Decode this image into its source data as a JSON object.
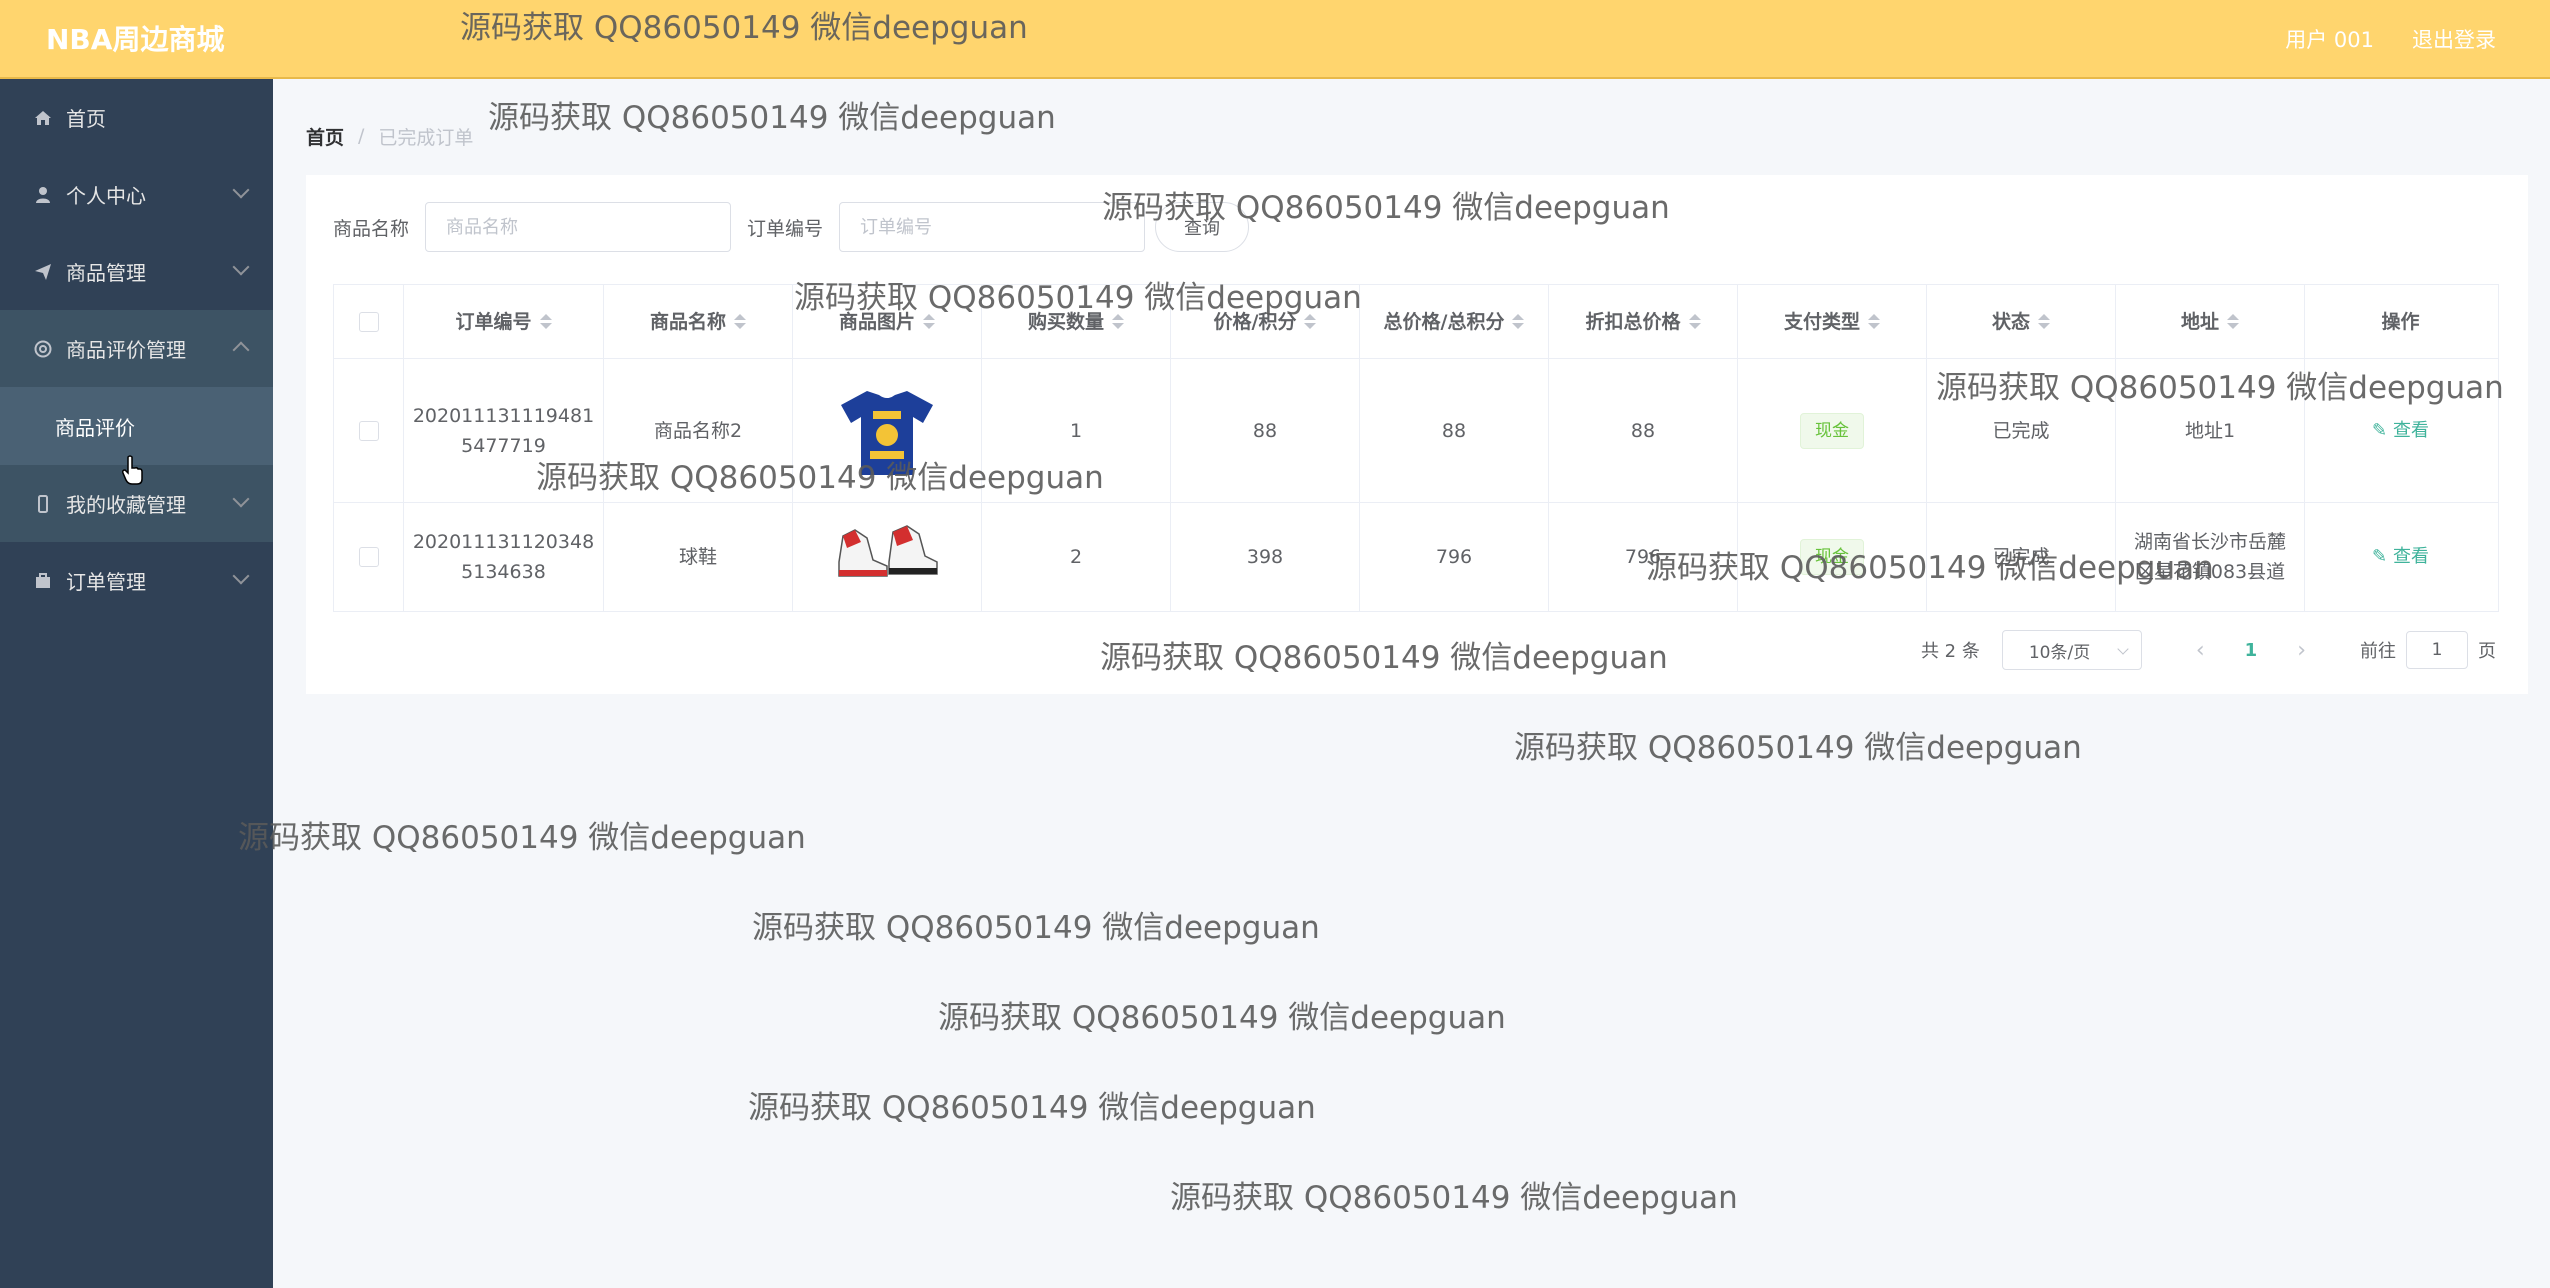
{
  "header": {
    "brand": "NBA周边商城",
    "user": "用户 001",
    "logout": "退出登录"
  },
  "sidebar": {
    "items": [
      {
        "label": "首页",
        "icon": "home-icon"
      },
      {
        "label": "个人中心",
        "icon": "user-icon"
      },
      {
        "label": "商品管理",
        "icon": "send-icon"
      },
      {
        "label": "商品评价管理",
        "icon": "help-icon"
      },
      {
        "label": "我的收藏管理",
        "icon": "phone-icon"
      },
      {
        "label": "订单管理",
        "icon": "shopping-bag-icon"
      }
    ],
    "subitem": "商品评价"
  },
  "breadcrumb": {
    "home": "首页",
    "separator": "/",
    "current": "已完成订单"
  },
  "search": {
    "product_label": "商品名称",
    "product_placeholder": "商品名称",
    "order_label": "订单编号",
    "order_placeholder": "订单编号",
    "button": "查询"
  },
  "table": {
    "headers": [
      "订单编号",
      "商品名称",
      "商品图片",
      "购买数量",
      "价格/积分",
      "总价格/总积分",
      "折扣总价格",
      "支付类型",
      "状态",
      "地址",
      "操作"
    ],
    "rows": [
      {
        "order_no_1": "202011131119481",
        "order_no_2": "5477719",
        "name": "商品名称2",
        "image": "tshirt",
        "qty": "1",
        "price": "88",
        "total": "88",
        "discount": "88",
        "pay": "现金",
        "status": "已完成",
        "addr_1": "地址1",
        "addr_2": "",
        "action": "查看"
      },
      {
        "order_no_1": "202011131120348",
        "order_no_2": "5134638",
        "name": "球鞋",
        "image": "sneaker",
        "qty": "2",
        "price": "398",
        "total": "796",
        "discount": "796",
        "pay": "现金",
        "status": "已完成",
        "addr_1": "湖南省长沙市岳麓",
        "addr_2": "区星花镇083县道",
        "action": "查看"
      }
    ]
  },
  "pagination": {
    "total": "共 2 条",
    "page_size": "10条/页",
    "prev": "‹",
    "current": "1",
    "next": "›",
    "goto_label": "前往",
    "goto_value": "1",
    "goto_suffix": "页"
  },
  "watermark": "源码获取 QQ86050149 微信deepguan",
  "colors": {
    "header_bg": "#ffd56e",
    "sidebar_bg": "#304156",
    "accent": "#3fb39b",
    "tag_green": "#67c23a"
  }
}
